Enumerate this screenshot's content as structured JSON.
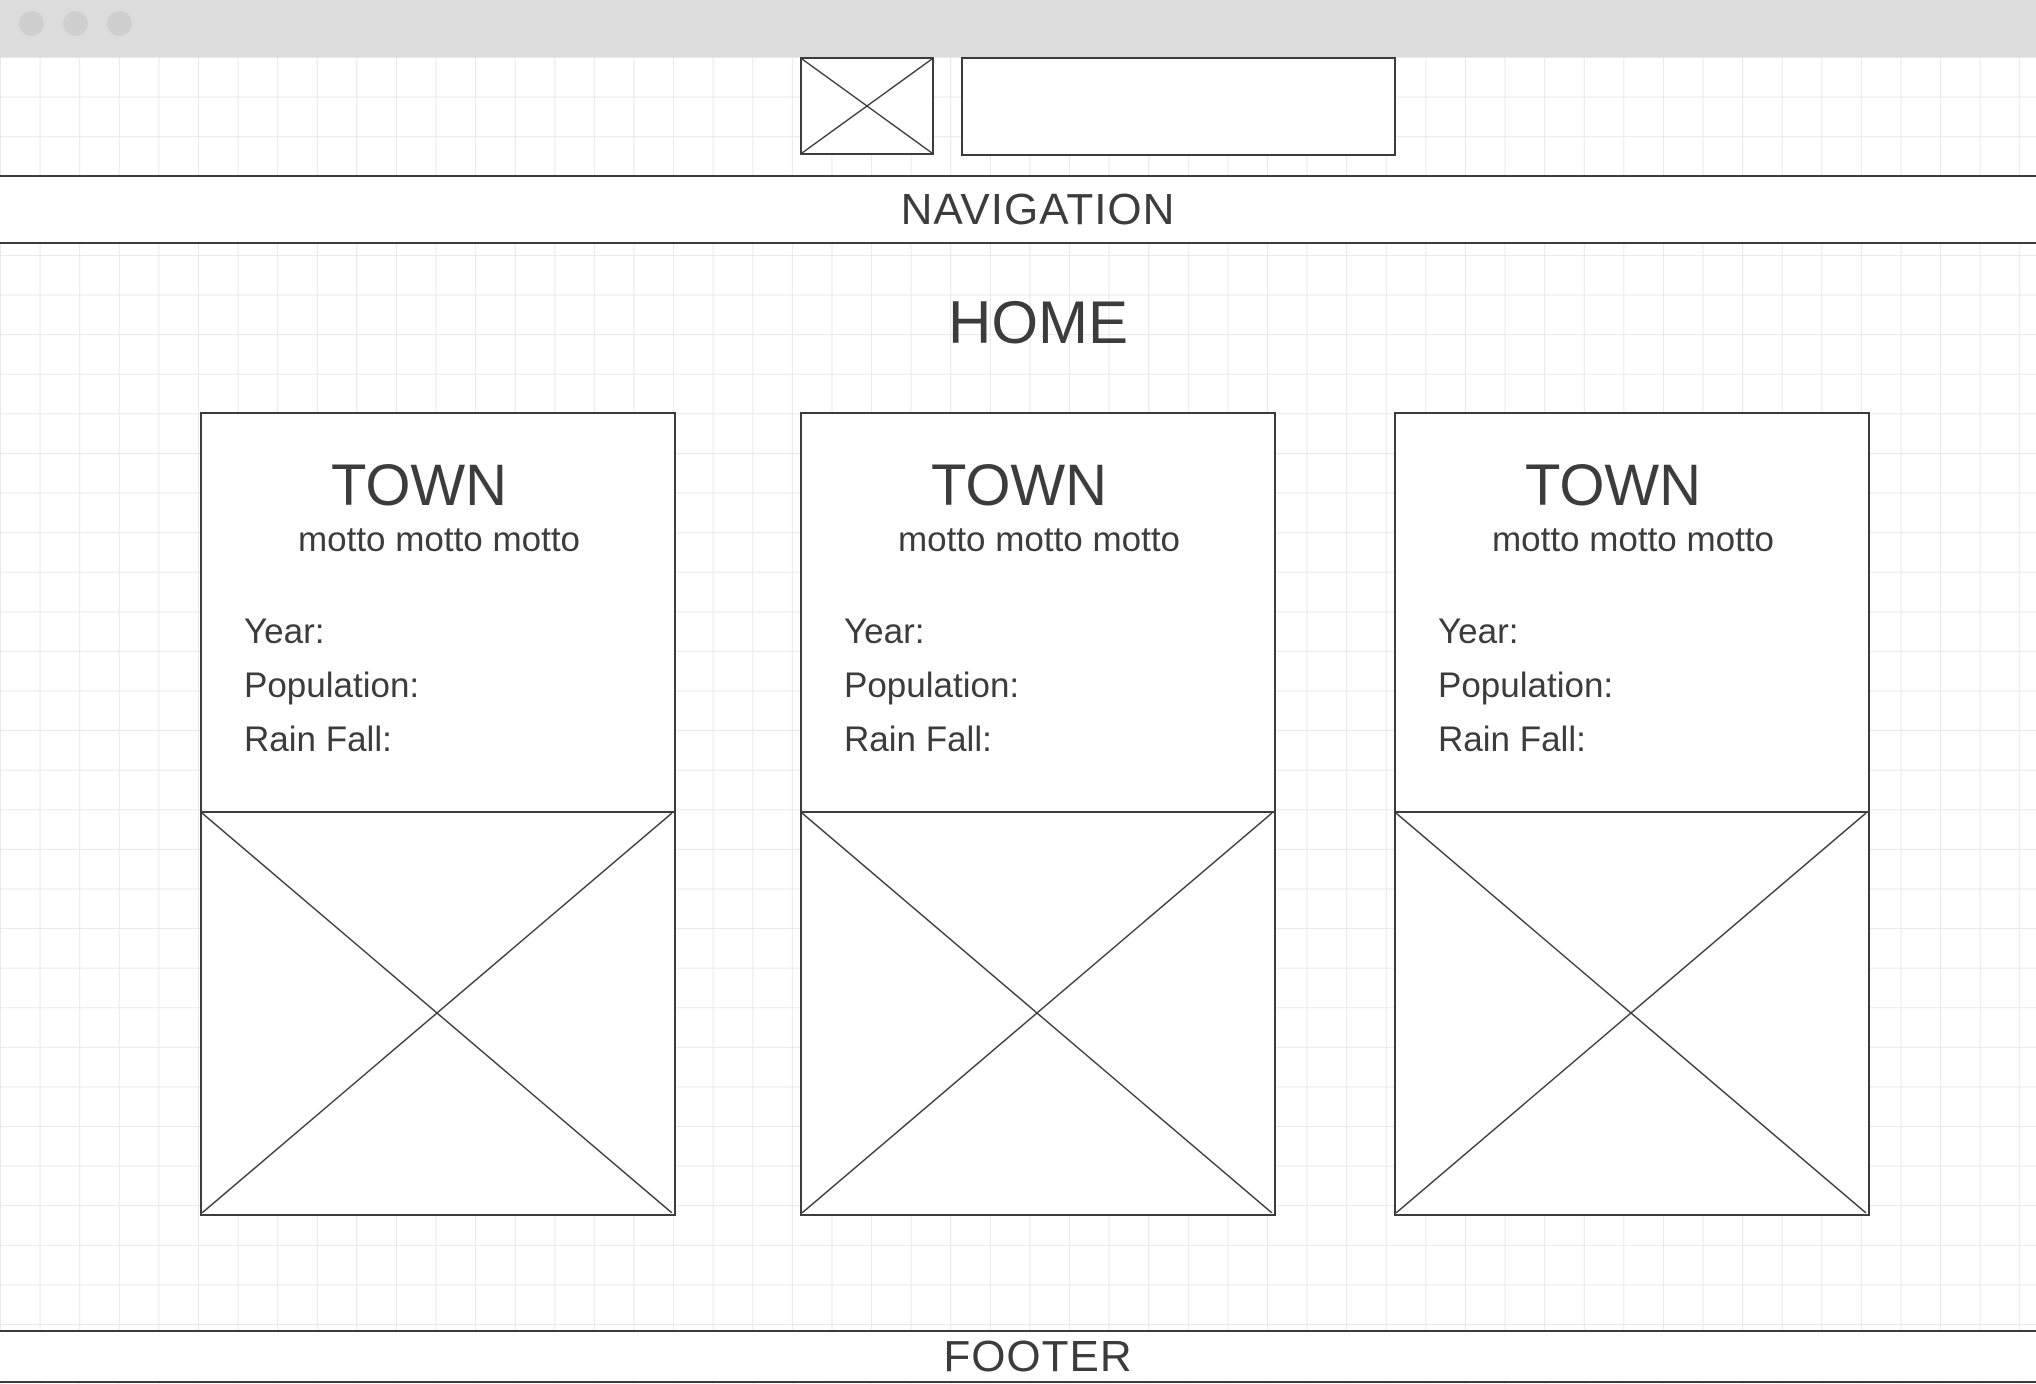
{
  "navigation": {
    "label": "NAVIGATION"
  },
  "page": {
    "heading": "HOME"
  },
  "cards": [
    {
      "title": "TOWN",
      "motto": "motto motto motto",
      "year_label": "Year:",
      "population_label": "Population:",
      "rainfall_label": "Rain Fall:"
    },
    {
      "title": "TOWN",
      "motto": "motto motto motto",
      "year_label": "Year:",
      "population_label": "Population:",
      "rainfall_label": "Rain Fall:"
    },
    {
      "title": "TOWN",
      "motto": "motto motto motto",
      "year_label": "Year:",
      "population_label": "Population:",
      "rainfall_label": "Rain Fall:"
    }
  ],
  "footer": {
    "label": "FOOTER"
  },
  "icons": {
    "logo": "image-placeholder-icon",
    "card_image": "image-placeholder-icon",
    "window_controls": [
      "window-dot-icon",
      "window-dot-icon",
      "window-dot-icon"
    ]
  },
  "colors": {
    "stroke": "#3c3c3c",
    "grid": "#e9e9e9",
    "titlebar": "#dcdcdc",
    "window_dot": "#cfcfcf"
  }
}
